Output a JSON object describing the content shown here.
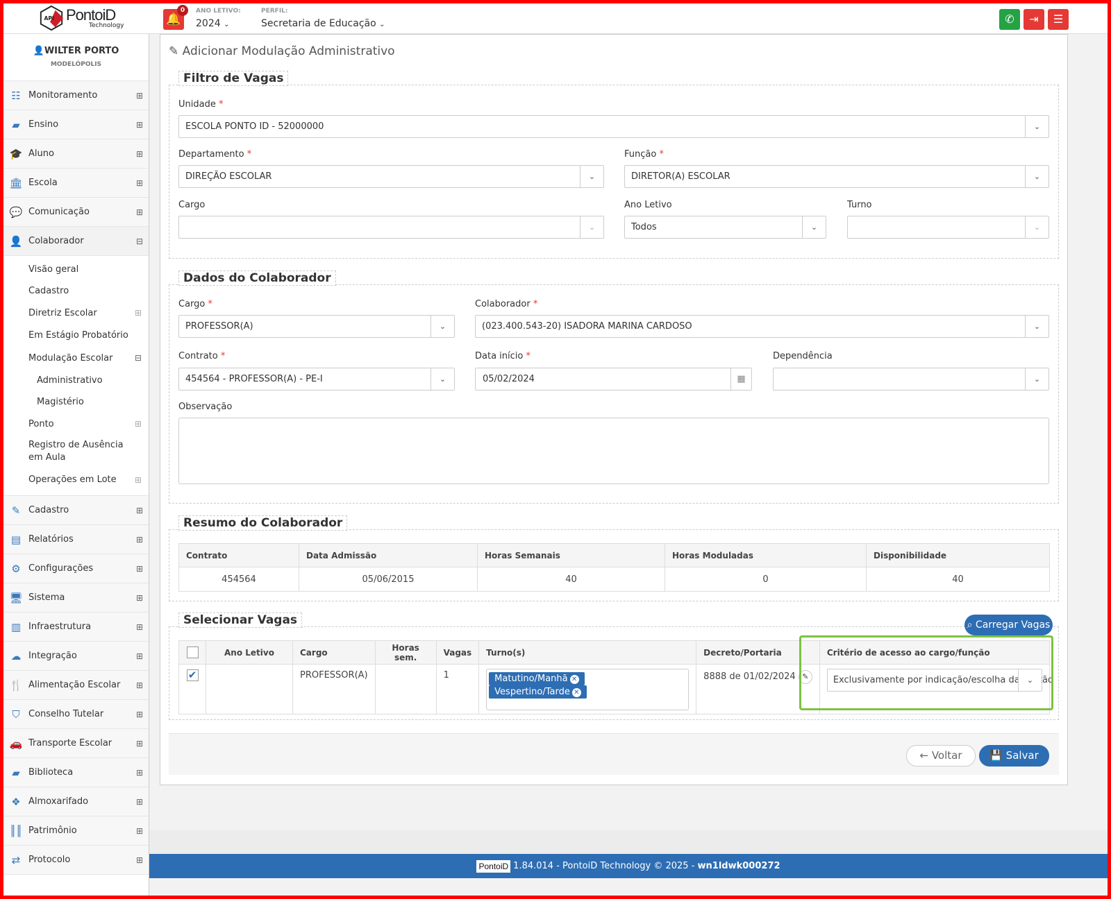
{
  "header": {
    "brand": "PontoiD",
    "brand_sub": "Technology",
    "logo_tag": "API",
    "notifications": "0",
    "ano_letivo_label": "ANO LETIVO:",
    "ano_letivo_value": "2024",
    "perfil_label": "PERFIL:",
    "perfil_value": "Secretaria de Educação",
    "colors": {
      "whatsapp": "#25a244",
      "logout": "#e53935",
      "menu": "#e53935"
    }
  },
  "user": {
    "name": "WILTER PORTO",
    "city": "MODELÓPOLIS"
  },
  "sidebar": {
    "top_items": [
      {
        "label": "Monitoramento",
        "icon": "sliders-icon"
      },
      {
        "label": "Ensino",
        "icon": "book-icon"
      },
      {
        "label": "Aluno",
        "icon": "graduation-cap-icon"
      },
      {
        "label": "Escola",
        "icon": "bank-icon"
      },
      {
        "label": "Comunicação",
        "icon": "comment-icon"
      },
      {
        "label": "Colaborador",
        "icon": "user-icon"
      }
    ],
    "colaborador_sub": [
      {
        "label": "Visão geral"
      },
      {
        "label": "Cadastro"
      },
      {
        "label": "Diretriz Escolar"
      },
      {
        "label": "Em Estágio Probatório"
      },
      {
        "label": "Modulação Escolar"
      },
      {
        "label": "Administrativo"
      },
      {
        "label": "Magistério"
      },
      {
        "label": "Ponto"
      },
      {
        "label": "Registro de Ausência em Aula"
      },
      {
        "label": "Operações em Lote"
      }
    ],
    "bottom_items": [
      {
        "label": "Cadastro",
        "icon": "edit-icon"
      },
      {
        "label": "Relatórios",
        "icon": "file-icon"
      },
      {
        "label": "Configurações",
        "icon": "cog-icon"
      },
      {
        "label": "Sistema",
        "icon": "desktop-icon"
      },
      {
        "label": "Infraestrutura",
        "icon": "building-icon"
      },
      {
        "label": "Integração",
        "icon": "cloud-icon"
      },
      {
        "label": "Alimentação Escolar",
        "icon": "cutlery-icon"
      },
      {
        "label": "Conselho Tutelar",
        "icon": "shield-icon"
      },
      {
        "label": "Transporte Escolar",
        "icon": "car-icon"
      },
      {
        "label": "Biblioteca",
        "icon": "book-icon"
      },
      {
        "label": "Almoxarifado",
        "icon": "cubes-icon"
      },
      {
        "label": "Patrimônio",
        "icon": "barcode-icon"
      },
      {
        "label": "Protocolo",
        "icon": "exchange-icon"
      }
    ]
  },
  "page": {
    "title": "Adicionar Modulação Administrativo"
  },
  "filtro": {
    "legend": "Filtro de Vagas",
    "unidade_label": "Unidade",
    "unidade_value": "ESCOLA PONTO ID - 52000000",
    "departamento_label": "Departamento",
    "departamento_value": "DIREÇÃO ESCOLAR",
    "funcao_label": "Função",
    "funcao_value": "DIRETOR(A) ESCOLAR",
    "cargo_label": "Cargo",
    "cargo_value": "",
    "ano_label": "Ano Letivo",
    "ano_value": "Todos",
    "turno_label": "Turno",
    "turno_value": ""
  },
  "dados": {
    "legend": "Dados do Colaborador",
    "cargo_label": "Cargo",
    "cargo_value": "PROFESSOR(A)",
    "colab_label": "Colaborador",
    "colab_value": "(023.400.543-20) ISADORA MARINA CARDOSO",
    "contrato_label": "Contrato",
    "contrato_value": "454564 - PROFESSOR(A) - PE-I",
    "data_label": "Data início",
    "data_value": "05/02/2024",
    "dep_label": "Dependência",
    "dep_value": "",
    "obs_label": "Observação"
  },
  "resumo": {
    "legend": "Resumo do Colaborador",
    "headers": [
      "Contrato",
      "Data Admissão",
      "Horas Semanais",
      "Horas Moduladas",
      "Disponibilidade"
    ],
    "row": [
      "454564",
      "05/06/2015",
      "40",
      "0",
      "40"
    ]
  },
  "vagas": {
    "legend": "Selecionar Vagas",
    "load_button": "Carregar Vagas",
    "headers": [
      "Ano Letivo",
      "Cargo",
      "Horas sem.",
      "Vagas",
      "Turno(s)",
      "Decreto/Portaria",
      "Critério de acesso ao cargo/função"
    ],
    "row": {
      "ano": "",
      "cargo": "PROFESSOR(A)",
      "horas": "",
      "vagas": "1",
      "turnos": [
        "Matutino/Manhã",
        "Vespertino/Tarde"
      ],
      "decreto": "8888 de 01/02/2024",
      "criterio": "Exclusivamente por indicação/escolha da gestão"
    },
    "highlight_color": "#7dc142"
  },
  "actions": {
    "voltar": "Voltar",
    "salvar": "Salvar"
  },
  "footer": {
    "logo": "PontoiD",
    "text": "1.84.014 - PontoiD Technology © 2025 - ",
    "host": "wn1ldwk000272"
  }
}
